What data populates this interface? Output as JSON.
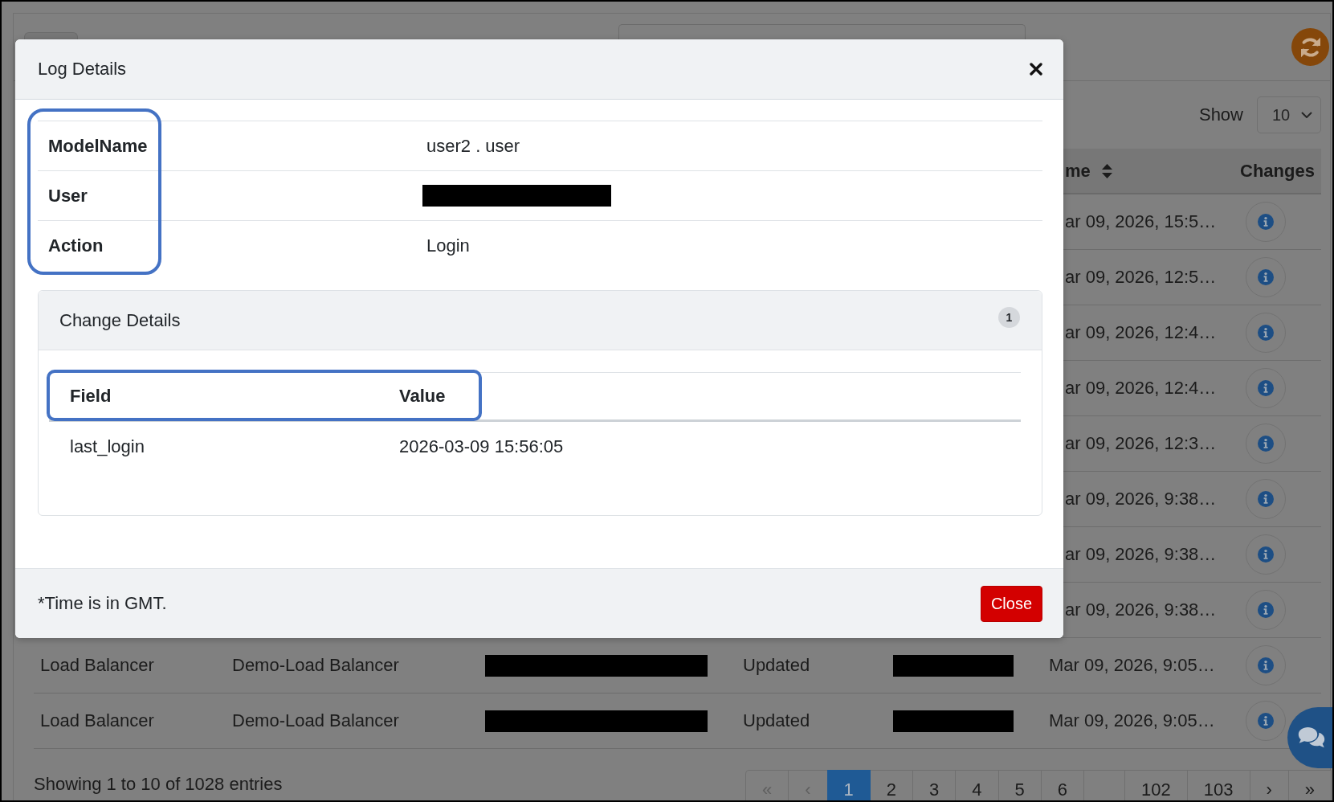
{
  "page": {
    "page_size": {
      "label": "Show",
      "value": "10"
    },
    "table": {
      "columns": [
        {},
        {},
        {},
        {},
        {},
        {
          "label": "me",
          "sortable": true
        },
        {
          "label": "Changes",
          "sortable": false
        }
      ],
      "rows_behind_dialog": [
        {
          "time": "ar 09, 2026, 15:5…"
        },
        {
          "time": "ar 09, 2026, 12:5…"
        },
        {
          "time": "ar 09, 2026, 12:4…"
        },
        {
          "time": "ar 09, 2026, 12:4…"
        },
        {
          "time": "ar 09, 2026, 12:3…"
        },
        {
          "time": "ar 09, 2026, 9:38…"
        },
        {
          "time": "ar 09, 2026, 9:38…"
        },
        {
          "time": "ar 09, 2026, 9:38…"
        }
      ],
      "rows": [
        {
          "cells": [
            {
              "kind": "text",
              "text": "Load Balancer"
            },
            {
              "kind": "text",
              "text": "Demo-Load Balancer"
            },
            {
              "kind": "redacted"
            },
            {
              "kind": "text",
              "text": "Updated"
            },
            {
              "kind": "redacted"
            },
            {
              "kind": "text",
              "text": "Mar 09, 2026, 9:05…"
            }
          ]
        },
        {
          "cells": [
            {
              "kind": "text",
              "text": "Load Balancer"
            },
            {
              "kind": "text",
              "text": "Demo-Load Balancer"
            },
            {
              "kind": "redacted"
            },
            {
              "kind": "text",
              "text": "Updated"
            },
            {
              "kind": "redacted"
            },
            {
              "kind": "text",
              "text": "Mar 09, 2026, 9:05…"
            }
          ]
        }
      ]
    },
    "entries_info": "Showing 1 to 10 of 1028 entries",
    "pagination": [
      {
        "kind": "page",
        "label": "«",
        "selected": false,
        "disabled": true
      },
      {
        "kind": "page",
        "label": "‹",
        "selected": false,
        "disabled": true
      },
      {
        "kind": "page",
        "label": "1",
        "selected": true,
        "disabled": false
      },
      {
        "kind": "page",
        "label": "2",
        "selected": false,
        "disabled": false
      },
      {
        "kind": "page",
        "label": "3",
        "selected": false,
        "disabled": false
      },
      {
        "kind": "page",
        "label": "4",
        "selected": false,
        "disabled": false
      },
      {
        "kind": "page",
        "label": "5",
        "selected": false,
        "disabled": false
      },
      {
        "kind": "page",
        "label": "6",
        "selected": false,
        "disabled": false
      },
      {
        "kind": "gap"
      },
      {
        "kind": "page",
        "label": "102",
        "selected": false,
        "disabled": false
      },
      {
        "kind": "page",
        "label": "103",
        "selected": false,
        "disabled": false
      },
      {
        "kind": "page",
        "label": "›",
        "selected": false,
        "disabled": false
      },
      {
        "kind": "page",
        "label": "»",
        "selected": false,
        "disabled": false
      }
    ]
  },
  "dialog": {
    "title": "Log Details",
    "fields": [
      {
        "label": "ModelName",
        "value": "user2 . user",
        "redacted": false
      },
      {
        "label": "User",
        "redacted": true
      },
      {
        "label": "Action",
        "value": "Login",
        "redacted": false
      }
    ],
    "change_details": {
      "title": "Change Details",
      "count": "1",
      "columns": [
        "Field",
        "Value"
      ],
      "rows": [
        {
          "field": "last_login",
          "value": "2026-03-09 15:56:05"
        }
      ]
    },
    "footnote": "*Time is in GMT.",
    "close_label": "Close"
  }
}
